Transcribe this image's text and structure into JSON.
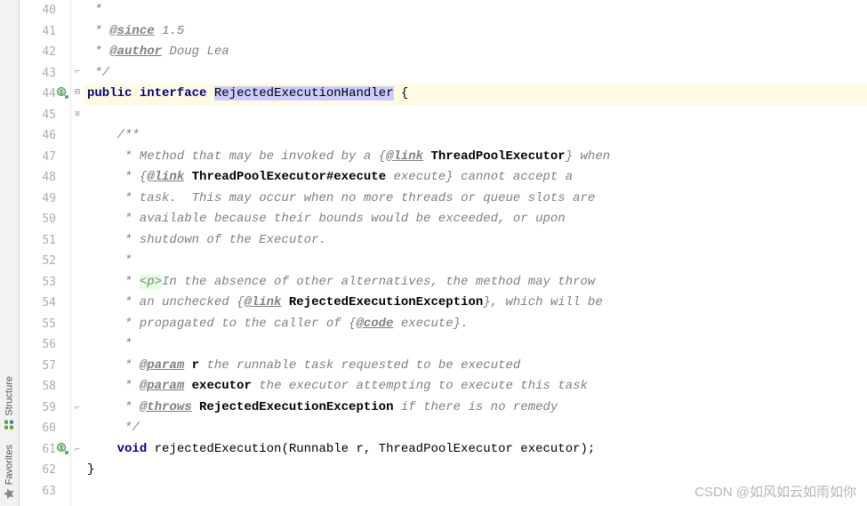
{
  "sideTabs": {
    "structure": "Structure",
    "favorites": "Favorites"
  },
  "lines": {
    "n40": "40",
    "n41": "41",
    "n42": "42",
    "n43": "43",
    "n44": "44",
    "n45": "45",
    "n46": "46",
    "n47": "47",
    "n48": "48",
    "n49": "49",
    "n50": "50",
    "n51": "51",
    "n52": "52",
    "n53": "53",
    "n54": "54",
    "n55": "55",
    "n56": "56",
    "n57": "57",
    "n58": "58",
    "n59": "59",
    "n60": "60",
    "n61": "61",
    "n62": "62",
    "n63": "63"
  },
  "code": {
    "l40": " *",
    "l41a": " * ",
    "l41tag": "@since",
    "l41b": " 1.5",
    "l42a": " * ",
    "l42tag": "@author",
    "l42b": " Doug Lea",
    "l43": " */",
    "l44a": "public",
    "l44b": "interface",
    "l44c": "RejectedExecutionHandler",
    "l44d": " {",
    "l46": "    /**",
    "l47a": "     * Method that may be invoked by a {",
    "l47tag": "@link",
    "l47b": " ",
    "l47type": "ThreadPoolExecutor",
    "l47c": "} when",
    "l48a": "     * {",
    "l48tag": "@link",
    "l48b": " ",
    "l48type": "ThreadPoolExecutor",
    "l48c": "#",
    "l48m": "execute",
    "l48d": " execute} cannot accept a",
    "l49": "     * task.  This may occur when no more threads or queue slots are",
    "l50": "     * available because their bounds would be exceeded, or upon",
    "l51": "     * shutdown of the Executor.",
    "l52": "     *",
    "l53a": "     * ",
    "l53p": "<p>",
    "l53b": "In the absence of other alternatives, the method may throw",
    "l54a": "     * an unchecked {",
    "l54tag": "@link",
    "l54b": " ",
    "l54type": "RejectedExecutionException",
    "l54c": "}, which will be",
    "l55a": "     * propagated to the caller of {",
    "l55tag": "@code",
    "l55b": " execute}.",
    "l56": "     *",
    "l57a": "     * ",
    "l57tag": "@param",
    "l57b": " ",
    "l57name": "r",
    "l57c": " the runnable task requested to be executed",
    "l58a": "     * ",
    "l58tag": "@param",
    "l58b": " ",
    "l58name": "executor",
    "l58c": " the executor attempting to execute this task",
    "l59a": "     * ",
    "l59tag": "@throws",
    "l59b": " ",
    "l59type": "RejectedExecutionException",
    "l59c": " if there is no remedy",
    "l60": "     */",
    "l61a": "    ",
    "l61kw": "void",
    "l61b": " ",
    "l61m": "rejectedExecution",
    "l61c": "(Runnable r, ThreadPoolExecutor executor);",
    "l62": "}"
  },
  "watermark": "CSDN @如风如云如雨如你"
}
